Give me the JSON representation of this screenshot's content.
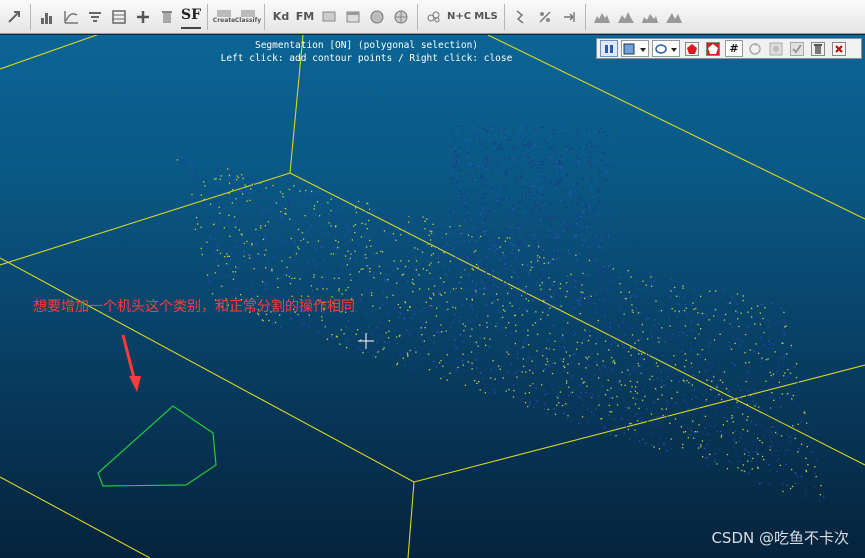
{
  "toolbar": {
    "sf_label": "SF",
    "kd_label": "Kd",
    "fm_label": "FM",
    "nc_label": "N+C",
    "mls_label": "MLS",
    "create_label": "Create",
    "classify_label": "Classify"
  },
  "viewport": {
    "status_line1": "Segmentation [ON] (polygonal selection)",
    "status_line2": "Left click: add contour points / Right click: close",
    "annotation_text": "想要增加一个机头这个类别，和正常分割的操作相同",
    "watermark": "CSDN @吃鱼不卡次",
    "colors": {
      "grid_line": "#d7d723",
      "polygon_outline": "#22c93a",
      "annotation": "#ff3a3a"
    }
  },
  "seg_toolbar": {
    "grid_button_label": "#"
  }
}
